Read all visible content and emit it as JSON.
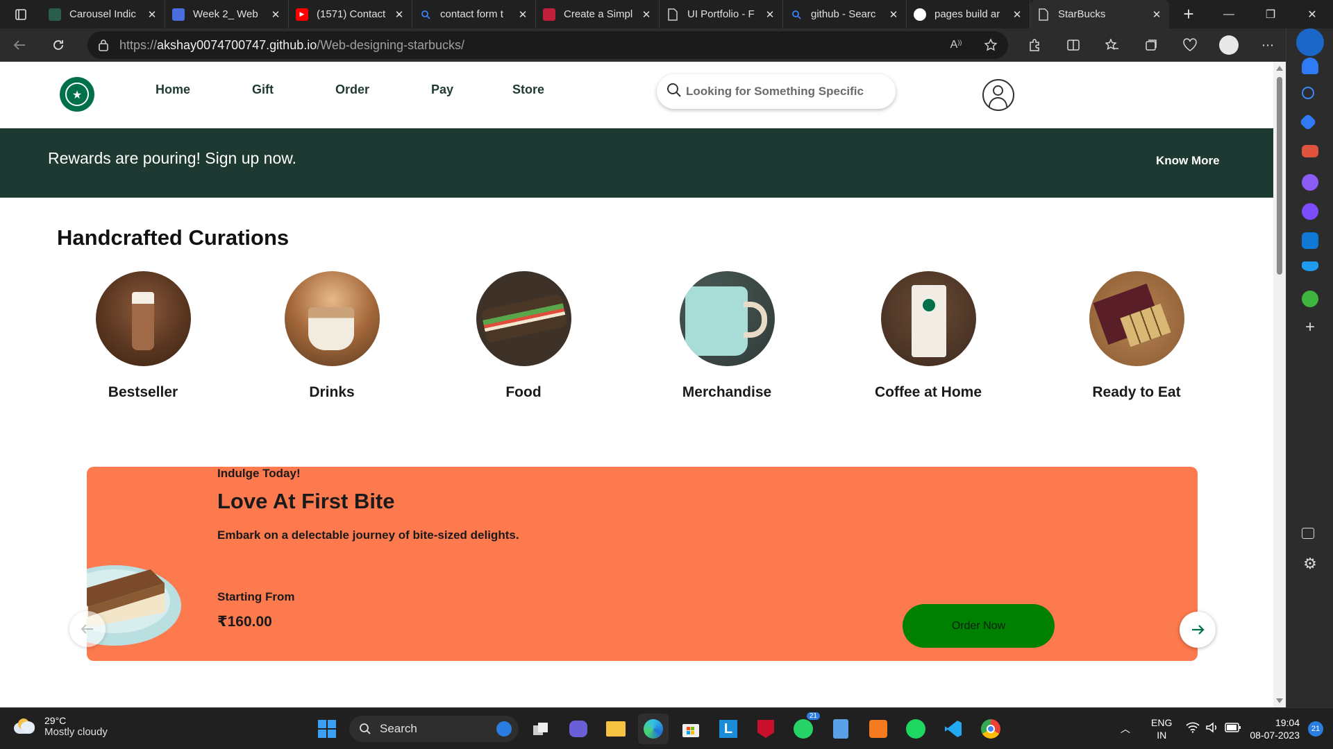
{
  "browser": {
    "tabs": [
      {
        "title": "Carousel Indic",
        "icon": "openai-icon",
        "color": "#2b5d4c"
      },
      {
        "title": "Week 2_ Web",
        "icon": "docs-icon",
        "color": "#4a6ee0"
      },
      {
        "title": "(1571) Contact",
        "icon": "youtube-icon",
        "color": "#ff0000"
      },
      {
        "title": "contact form t",
        "icon": "search-icon",
        "color": "#3b82f6"
      },
      {
        "title": "Create a Simpl",
        "icon": "site-icon",
        "color": "#c0203a"
      },
      {
        "title": "UI Portfolio - F",
        "icon": "page-icon",
        "color": "#cccccc"
      },
      {
        "title": "github - Searc",
        "icon": "search-icon",
        "color": "#3b82f6"
      },
      {
        "title": "pages build ar",
        "icon": "github-icon",
        "color": "#ffffff"
      },
      {
        "title": "StarBucks",
        "icon": "page-icon",
        "color": "#cccccc",
        "active": true
      }
    ],
    "url_prefix": "https://",
    "url_host": "akshay0074700747.github.io",
    "url_path": "/Web-designing-starbucks/"
  },
  "site": {
    "nav": [
      "Home",
      "Gift",
      "Order",
      "Pay",
      "Store"
    ],
    "search_placeholder": "Looking for Something Specific ?",
    "rewards": {
      "message": "Rewards are pouring! Sign up now.",
      "cta": "Know More"
    },
    "curations": {
      "title": "Handcrafted Curations",
      "items": [
        "Bestseller",
        "Drinks",
        "Food",
        "Merchandise",
        "Coffee at Home",
        "Ready to Eat"
      ]
    },
    "promo": {
      "kicker": "Indulge Today!",
      "title": "Love At First Bite",
      "description": "Embark on a delectable journey of bite-sized delights.",
      "from_label": "Starting From",
      "price": "₹160.00",
      "cta": "Order Now"
    }
  },
  "taskbar": {
    "temperature": "29°C",
    "weather": "Mostly cloudy",
    "search": "Search",
    "lang_1": "ENG",
    "lang_2": "IN",
    "time": "19:04",
    "date": "08-07-2023",
    "whatsapp_badge": "21",
    "notif_badge": "21"
  },
  "colors": {
    "starbucks_green": "#00704a",
    "rewards_bg": "#1e3932",
    "promo_bg": "#fd794e",
    "order_button": "#008000"
  }
}
